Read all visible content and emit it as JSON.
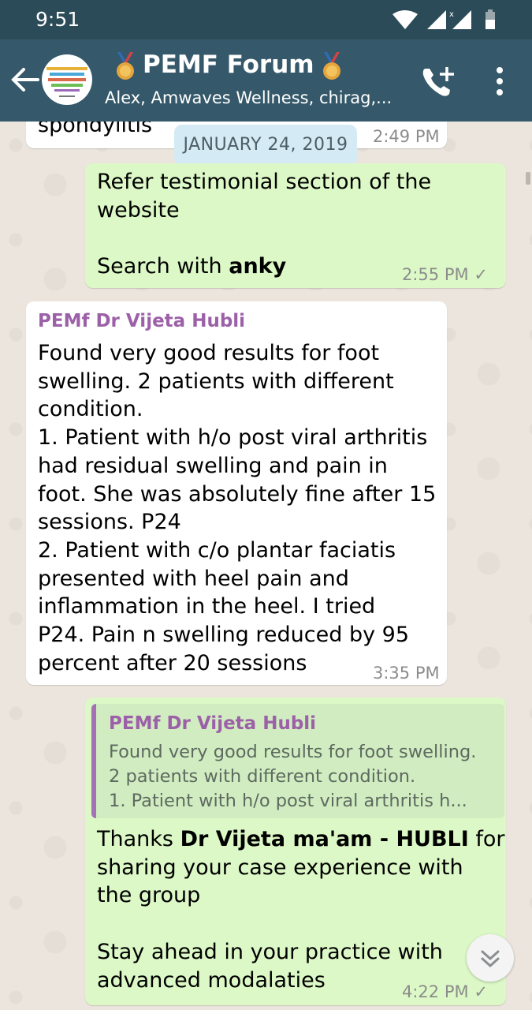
{
  "status_bar": {
    "time": "9:51"
  },
  "header": {
    "title": "PEMF Forum",
    "subtitle": "Alex, Amwaves Wellness, chirag,..."
  },
  "date_separator": "JANUARY 24, 2019",
  "messages": [
    {
      "direction": "in",
      "text_fragment": "spondylitis",
      "time": "2:49 PM"
    },
    {
      "direction": "out",
      "line1": "Refer testimonial section of the",
      "line2": "website",
      "search_prefix": "Search with ",
      "search_bold": "anky",
      "time": "2:55 PM"
    },
    {
      "direction": "in",
      "sender": "PEMf Dr Vijeta Hubli",
      "lines": [
        "Found very good results for foot",
        "swelling.  2 patients with different",
        "condition.",
        "1. Patient with h/o post viral arthritis",
        "had residual swelling and pain in",
        "foot.  She was absolutely fine after 15",
        "sessions. P24",
        "2. Patient with c/o plantar faciatis",
        "presented with heel pain and",
        "inflammation in the heel.  I tried",
        "P24.  Pain n swelling reduced by 95",
        "percent after 20 sessions"
      ],
      "time": "3:35 PM"
    },
    {
      "direction": "out",
      "quote": {
        "sender": "PEMf Dr Vijeta Hubli",
        "lines": [
          "Found very good results for foot swelling.",
          "2 patients with different condition.",
          "1. Patient with h/o post viral arthritis h..."
        ]
      },
      "thanks_prefix": "Thanks ",
      "thanks_bold": "Dr Vijeta ma'am -  HUBLI",
      "thanks_suffix": " for",
      "line2": "sharing your case experience with",
      "line3": "the group",
      "line4": "Stay ahead in your practice with",
      "line5": "advanced modalaties",
      "time": "4:22 PM"
    }
  ],
  "colors": {
    "status_bar": "#2c4b58",
    "app_bar": "#35596a",
    "outgoing_bubble": "#dcf8c6",
    "incoming_bubble": "#ffffff",
    "sender_name": "#9c60a8",
    "chat_background": "#ece5dd"
  },
  "icons": {
    "back": "arrow-left-icon",
    "call": "add-call-icon",
    "menu": "more-vert-icon",
    "scroll_down": "double-chevron-down-icon"
  }
}
